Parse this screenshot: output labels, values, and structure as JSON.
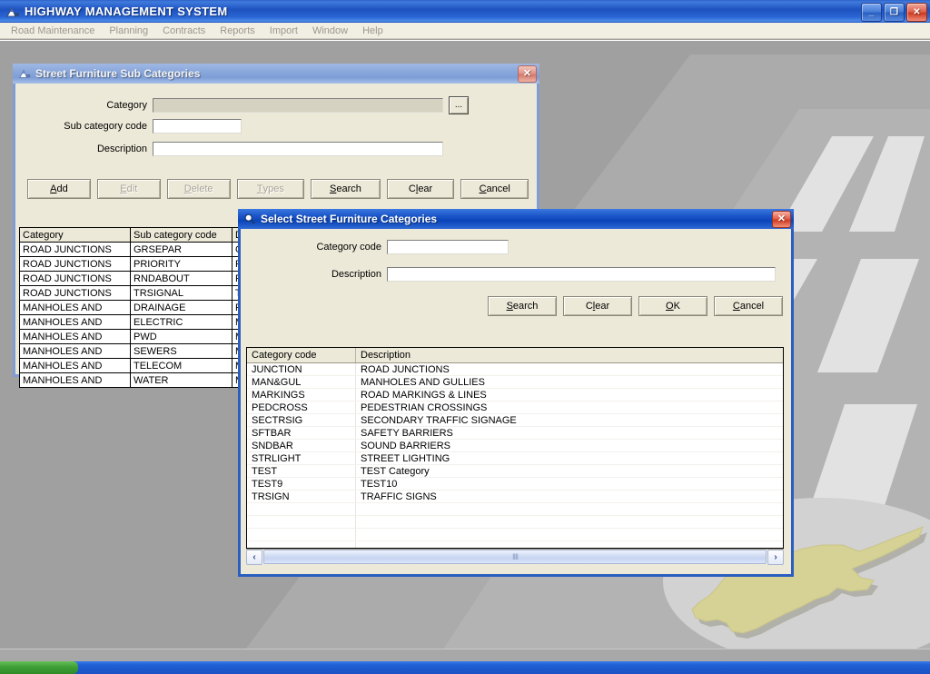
{
  "app": {
    "title": "HIGHWAY MANAGEMENT SYSTEM",
    "icon": "app-icon",
    "window_buttons": {
      "minimize": "_",
      "restore": "❐",
      "close": "✕"
    },
    "menu": [
      "Road Maintenance",
      "Planning",
      "Contracts",
      "Reports",
      "Import",
      "Window",
      "Help"
    ]
  },
  "sub_categories_dialog": {
    "title": "Street Furniture Sub Categories",
    "icon": "app-icon",
    "close_label": "✕",
    "fields": {
      "category": {
        "label": "Category",
        "value": "",
        "placeholder": "",
        "enabled": false
      },
      "sub_category_code": {
        "label": "Sub category code",
        "value": "",
        "placeholder": ""
      },
      "description": {
        "label": "Description",
        "value": "",
        "placeholder": ""
      }
    },
    "browse_button": "...",
    "buttons": [
      {
        "label": "Add",
        "accel": "A",
        "enabled": true
      },
      {
        "label": "Edit",
        "accel": "E",
        "enabled": false
      },
      {
        "label": "Delete",
        "accel": "D",
        "enabled": false
      },
      {
        "label": "Types",
        "accel": "T",
        "enabled": false
      },
      {
        "label": "Search",
        "accel": "S",
        "enabled": true
      },
      {
        "label": "Clear",
        "accel": "l",
        "enabled": true
      },
      {
        "label": "Cancel",
        "accel": "C",
        "enabled": true
      }
    ],
    "grid": {
      "columns": [
        "Category",
        "Sub category code",
        "Description"
      ],
      "rows": [
        [
          "ROAD JUNCTIONS",
          "GRSEPAR",
          "GR"
        ],
        [
          "ROAD JUNCTIONS",
          "PRIORITY",
          "PRI"
        ],
        [
          "ROAD JUNCTIONS",
          "RNDABOUT",
          "RO"
        ],
        [
          "ROAD JUNCTIONS",
          "TRSIGNAL",
          "TRA"
        ],
        [
          "MANHOLES AND",
          "DRAINAGE",
          "ROA"
        ],
        [
          "MANHOLES AND",
          "ELECTRIC",
          "MA"
        ],
        [
          "MANHOLES AND",
          "PWD",
          "MA"
        ],
        [
          "MANHOLES AND",
          "SEWERS",
          "MA"
        ],
        [
          "MANHOLES AND",
          "TELECOM",
          "MA"
        ],
        [
          "MANHOLES AND",
          "WATER",
          "MA"
        ]
      ]
    }
  },
  "select_categories_dialog": {
    "title": "Select Street Furniture Categories",
    "icon": "magnifier-icon",
    "close_label": "✕",
    "fields": {
      "category_code": {
        "label": "Category code",
        "value": "",
        "placeholder": "",
        "focused": true
      },
      "description": {
        "label": "Description",
        "value": "",
        "placeholder": ""
      }
    },
    "buttons": [
      {
        "label": "Search",
        "accel": "S"
      },
      {
        "label": "Clear",
        "accel": "l"
      },
      {
        "label": "OK",
        "accel": "O"
      },
      {
        "label": "Cancel",
        "accel": "C"
      }
    ],
    "list": {
      "columns": [
        "Category code",
        "Description"
      ],
      "rows": [
        [
          "JUNCTION",
          "ROAD JUNCTIONS"
        ],
        [
          "MAN&GUL",
          "MANHOLES AND GULLIES"
        ],
        [
          "MARKINGS",
          "ROAD MARKINGS & LINES"
        ],
        [
          "PEDCROSS",
          "PEDESTRIAN CROSSINGS"
        ],
        [
          "SECTRSIG",
          "SECONDARY TRAFFIC SIGNAGE"
        ],
        [
          "SFTBAR",
          "SAFETY BARRIERS"
        ],
        [
          "SNDBAR",
          "SOUND BARRIERS"
        ],
        [
          "STRLIGHT",
          "STREET LIGHTING"
        ],
        [
          "TEST",
          "TEST Category"
        ],
        [
          "TEST9",
          "TEST10"
        ],
        [
          "TRSIGN",
          "TRAFFIC SIGNS"
        ]
      ],
      "scrollbar": {
        "left_arrow": "‹",
        "right_arrow": "›",
        "grip": "IIII"
      }
    }
  },
  "colors": {
    "title_blue": "#1b56c8",
    "inactive_title": "#8aa8dc",
    "dialog_face": "#ece9d8",
    "close_red": "#cf3a20",
    "desktop_grey": "#a0a0a0",
    "cyprus_olive": "#d6d296"
  }
}
